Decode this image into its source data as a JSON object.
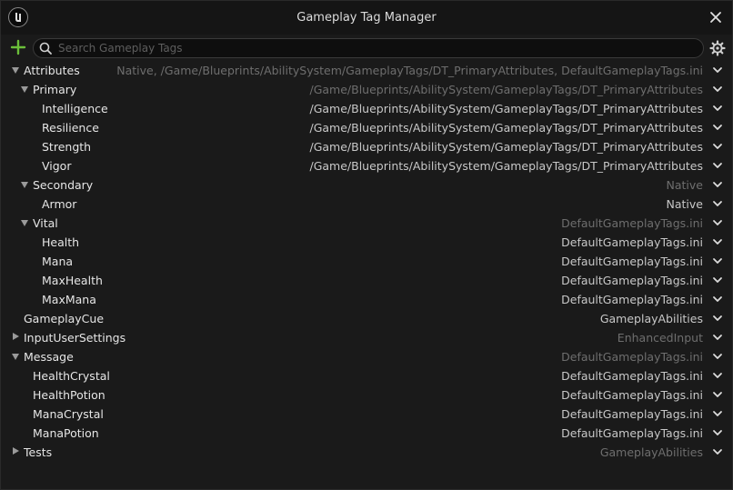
{
  "window": {
    "title": "Gameplay Tag Manager",
    "icons": {
      "logo": "unreal-logo-icon",
      "close": "close-icon"
    }
  },
  "toolbar": {
    "add_icon": "plus-icon",
    "search_placeholder": "Search Gameplay Tags",
    "settings_icon": "gear-icon"
  },
  "colors": {
    "accent_add": "#6bbf3a",
    "background": "#1a1a1a",
    "text": "#e6e6e6",
    "source_dim": "#6e6e6e",
    "source_bright": "#c8c8c8"
  },
  "tags": [
    {
      "label": "Attributes",
      "source": "Native, /Game/Blueprints/AbilitySystem/GameplayTags/DT_PrimaryAttributes, DefaultGameplayTags.ini",
      "depth": 0,
      "expander": "expanded",
      "dim": true
    },
    {
      "label": "Primary",
      "source": "/Game/Blueprints/AbilitySystem/GameplayTags/DT_PrimaryAttributes",
      "depth": 1,
      "expander": "expanded",
      "dim": true
    },
    {
      "label": "Intelligence",
      "source": "/Game/Blueprints/AbilitySystem/GameplayTags/DT_PrimaryAttributes",
      "depth": 2,
      "expander": "none",
      "dim": false
    },
    {
      "label": "Resilience",
      "source": "/Game/Blueprints/AbilitySystem/GameplayTags/DT_PrimaryAttributes",
      "depth": 2,
      "expander": "none",
      "dim": false
    },
    {
      "label": "Strength",
      "source": "/Game/Blueprints/AbilitySystem/GameplayTags/DT_PrimaryAttributes",
      "depth": 2,
      "expander": "none",
      "dim": false
    },
    {
      "label": "Vigor",
      "source": "/Game/Blueprints/AbilitySystem/GameplayTags/DT_PrimaryAttributes",
      "depth": 2,
      "expander": "none",
      "dim": false
    },
    {
      "label": "Secondary",
      "source": "Native",
      "depth": 1,
      "expander": "expanded",
      "dim": true
    },
    {
      "label": "Armor",
      "source": "Native",
      "depth": 2,
      "expander": "none",
      "dim": false
    },
    {
      "label": "Vital",
      "source": "DefaultGameplayTags.ini",
      "depth": 1,
      "expander": "expanded",
      "dim": true
    },
    {
      "label": "Health",
      "source": "DefaultGameplayTags.ini",
      "depth": 2,
      "expander": "none",
      "dim": false
    },
    {
      "label": "Mana",
      "source": "DefaultGameplayTags.ini",
      "depth": 2,
      "expander": "none",
      "dim": false
    },
    {
      "label": "MaxHealth",
      "source": "DefaultGameplayTags.ini",
      "depth": 2,
      "expander": "none",
      "dim": false
    },
    {
      "label": "MaxMana",
      "source": "DefaultGameplayTags.ini",
      "depth": 2,
      "expander": "none",
      "dim": false
    },
    {
      "label": "GameplayCue",
      "source": "GameplayAbilities",
      "depth": 0,
      "expander": "none",
      "dim": false
    },
    {
      "label": "InputUserSettings",
      "source": "EnhancedInput",
      "depth": 0,
      "expander": "collapsed",
      "dim": true
    },
    {
      "label": "Message",
      "source": "DefaultGameplayTags.ini",
      "depth": 0,
      "expander": "expanded",
      "dim": true
    },
    {
      "label": "HealthCrystal",
      "source": "DefaultGameplayTags.ini",
      "depth": 1,
      "expander": "none",
      "dim": false
    },
    {
      "label": "HealthPotion",
      "source": "DefaultGameplayTags.ini",
      "depth": 1,
      "expander": "none",
      "dim": false
    },
    {
      "label": "ManaCrystal",
      "source": "DefaultGameplayTags.ini",
      "depth": 1,
      "expander": "none",
      "dim": false
    },
    {
      "label": "ManaPotion",
      "source": "DefaultGameplayTags.ini",
      "depth": 1,
      "expander": "none",
      "dim": false
    },
    {
      "label": "Tests",
      "source": "GameplayAbilities",
      "depth": 0,
      "expander": "collapsed",
      "dim": true
    }
  ]
}
